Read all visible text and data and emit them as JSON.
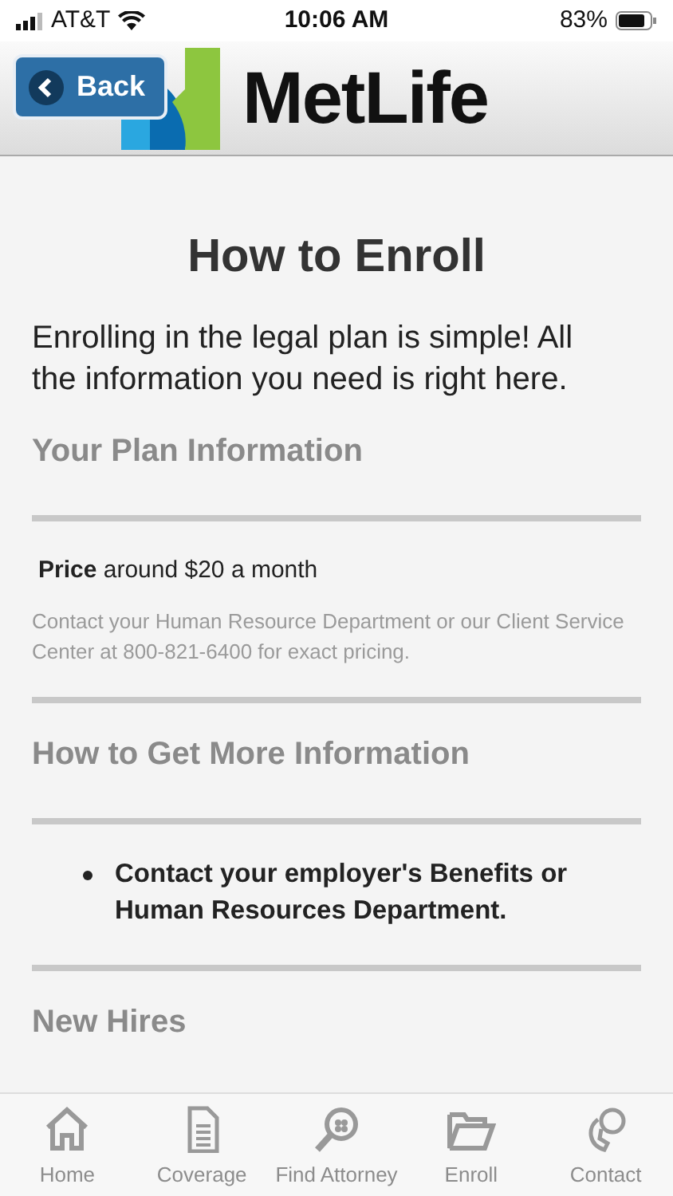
{
  "status_bar": {
    "carrier": "AT&T",
    "time": "10:06 AM",
    "battery": "83%"
  },
  "header": {
    "back": "Back",
    "logo": "MetLife"
  },
  "title": "How to Enroll",
  "intro": "Enrolling in the legal plan is simple! All the information you need is right here.",
  "sections": [
    {
      "heading": "Your Plan Information",
      "kind": "price",
      "price_label": "Price",
      "price_value": "around $20 a month",
      "note": "Contact your Human Resource Department or our Client Service Center at 800-821-6400 for exact pricing."
    },
    {
      "heading": "How to Get More Information",
      "kind": "bullets",
      "bullets": [
        "Contact your employer's Benefits or Human Resources Department."
      ]
    },
    {
      "heading": "New Hires",
      "kind": "plain"
    }
  ],
  "tabs": [
    {
      "label": "Home",
      "kind": "home",
      "selected": false
    },
    {
      "label": "Coverage",
      "kind": "doc",
      "selected": false
    },
    {
      "label": "Find Attorney",
      "kind": "search",
      "selected": false
    },
    {
      "label": "Enroll",
      "kind": "folder",
      "selected": false
    },
    {
      "label": "Contact",
      "kind": "contact",
      "selected": false
    }
  ]
}
